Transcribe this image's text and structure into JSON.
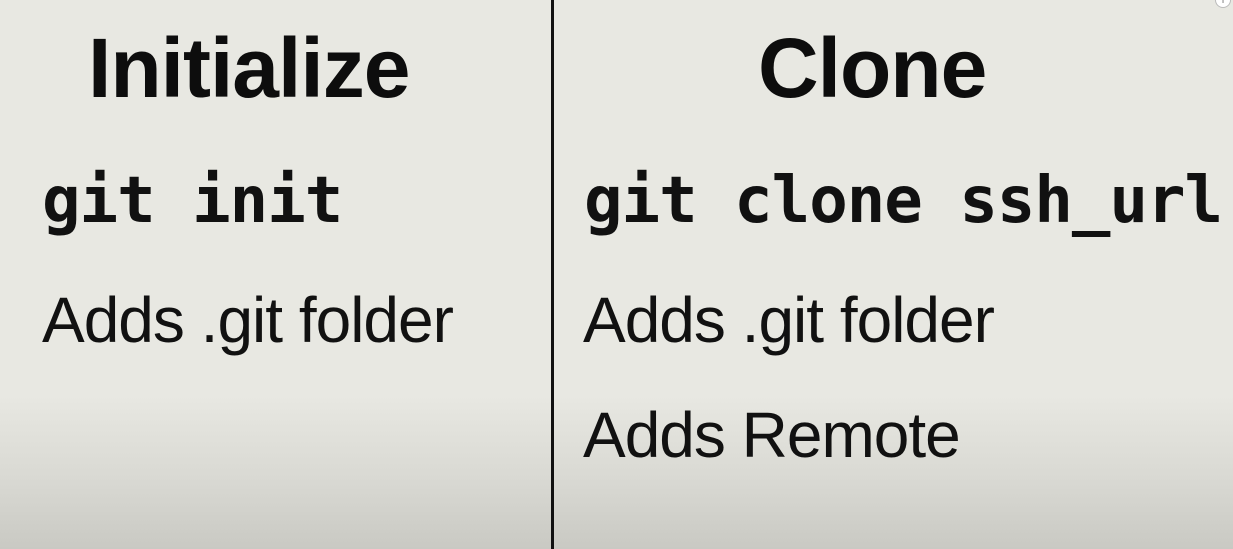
{
  "left_panel": {
    "heading": "Initialize",
    "command": "git init",
    "points": [
      "Adds .git folder"
    ]
  },
  "right_panel": {
    "heading": "Clone",
    "command": "git clone ssh_url",
    "points": [
      "Adds .git folder",
      "Adds Remote"
    ]
  },
  "colors": {
    "background": "#e8e8e2",
    "text": "#111111",
    "divider": "#111111"
  },
  "icons": {
    "corner": "info-icon"
  }
}
